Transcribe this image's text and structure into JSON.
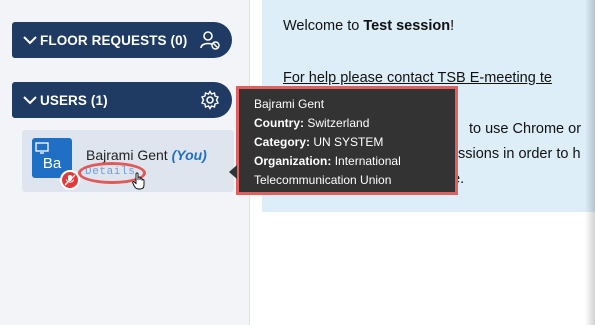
{
  "sidebar": {
    "floor_requests": {
      "label": "FLOOR REQUESTS (0)",
      "icon": "user-remove-icon"
    },
    "users": {
      "label": "USERS (1)",
      "icon": "gear-icon"
    }
  },
  "user_card": {
    "avatar_initials": "Ba",
    "name": "Bajrami Gent",
    "you_tag": "(You)",
    "details_link": "Details",
    "status_badge": "mic-muted-icon"
  },
  "tooltip": {
    "name": "Bajrami Gent",
    "country_label": "Country:",
    "country_value": "Switzerland",
    "category_label": "Category:",
    "category_value": "UN SYSTEM",
    "organization_label": "Organization:",
    "organization_value": "International",
    "organization_value_line2": "Telecommunication Union"
  },
  "content": {
    "welcome_prefix": "Welcome to ",
    "session_name": "Test session",
    "welcome_suffix": "!",
    "help_text": "For help please contact TSB E-meeting te",
    "partial_line1": "to use Chrome or",
    "partial_line2": "ssions in order to h",
    "partial_line3": "e."
  },
  "colors": {
    "sidebar_header": "#1f3b63",
    "accent_blue": "#1f6fc5",
    "highlight_red": "#e05a5a",
    "content_bg": "#ddeef9"
  }
}
